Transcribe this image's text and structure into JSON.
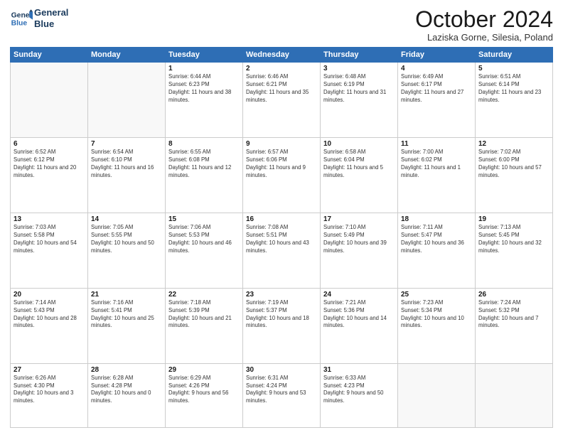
{
  "logo": {
    "line1": "General",
    "line2": "Blue"
  },
  "title": "October 2024",
  "subtitle": "Laziska Gorne, Silesia, Poland",
  "days_of_week": [
    "Sunday",
    "Monday",
    "Tuesday",
    "Wednesday",
    "Thursday",
    "Friday",
    "Saturday"
  ],
  "weeks": [
    [
      {
        "day": "",
        "sunrise": "",
        "sunset": "",
        "daylight": ""
      },
      {
        "day": "",
        "sunrise": "",
        "sunset": "",
        "daylight": ""
      },
      {
        "day": "1",
        "sunrise": "Sunrise: 6:44 AM",
        "sunset": "Sunset: 6:23 PM",
        "daylight": "Daylight: 11 hours and 38 minutes."
      },
      {
        "day": "2",
        "sunrise": "Sunrise: 6:46 AM",
        "sunset": "Sunset: 6:21 PM",
        "daylight": "Daylight: 11 hours and 35 minutes."
      },
      {
        "day": "3",
        "sunrise": "Sunrise: 6:48 AM",
        "sunset": "Sunset: 6:19 PM",
        "daylight": "Daylight: 11 hours and 31 minutes."
      },
      {
        "day": "4",
        "sunrise": "Sunrise: 6:49 AM",
        "sunset": "Sunset: 6:17 PM",
        "daylight": "Daylight: 11 hours and 27 minutes."
      },
      {
        "day": "5",
        "sunrise": "Sunrise: 6:51 AM",
        "sunset": "Sunset: 6:14 PM",
        "daylight": "Daylight: 11 hours and 23 minutes."
      }
    ],
    [
      {
        "day": "6",
        "sunrise": "Sunrise: 6:52 AM",
        "sunset": "Sunset: 6:12 PM",
        "daylight": "Daylight: 11 hours and 20 minutes."
      },
      {
        "day": "7",
        "sunrise": "Sunrise: 6:54 AM",
        "sunset": "Sunset: 6:10 PM",
        "daylight": "Daylight: 11 hours and 16 minutes."
      },
      {
        "day": "8",
        "sunrise": "Sunrise: 6:55 AM",
        "sunset": "Sunset: 6:08 PM",
        "daylight": "Daylight: 11 hours and 12 minutes."
      },
      {
        "day": "9",
        "sunrise": "Sunrise: 6:57 AM",
        "sunset": "Sunset: 6:06 PM",
        "daylight": "Daylight: 11 hours and 9 minutes."
      },
      {
        "day": "10",
        "sunrise": "Sunrise: 6:58 AM",
        "sunset": "Sunset: 6:04 PM",
        "daylight": "Daylight: 11 hours and 5 minutes."
      },
      {
        "day": "11",
        "sunrise": "Sunrise: 7:00 AM",
        "sunset": "Sunset: 6:02 PM",
        "daylight": "Daylight: 11 hours and 1 minute."
      },
      {
        "day": "12",
        "sunrise": "Sunrise: 7:02 AM",
        "sunset": "Sunset: 6:00 PM",
        "daylight": "Daylight: 10 hours and 57 minutes."
      }
    ],
    [
      {
        "day": "13",
        "sunrise": "Sunrise: 7:03 AM",
        "sunset": "Sunset: 5:58 PM",
        "daylight": "Daylight: 10 hours and 54 minutes."
      },
      {
        "day": "14",
        "sunrise": "Sunrise: 7:05 AM",
        "sunset": "Sunset: 5:55 PM",
        "daylight": "Daylight: 10 hours and 50 minutes."
      },
      {
        "day": "15",
        "sunrise": "Sunrise: 7:06 AM",
        "sunset": "Sunset: 5:53 PM",
        "daylight": "Daylight: 10 hours and 46 minutes."
      },
      {
        "day": "16",
        "sunrise": "Sunrise: 7:08 AM",
        "sunset": "Sunset: 5:51 PM",
        "daylight": "Daylight: 10 hours and 43 minutes."
      },
      {
        "day": "17",
        "sunrise": "Sunrise: 7:10 AM",
        "sunset": "Sunset: 5:49 PM",
        "daylight": "Daylight: 10 hours and 39 minutes."
      },
      {
        "day": "18",
        "sunrise": "Sunrise: 7:11 AM",
        "sunset": "Sunset: 5:47 PM",
        "daylight": "Daylight: 10 hours and 36 minutes."
      },
      {
        "day": "19",
        "sunrise": "Sunrise: 7:13 AM",
        "sunset": "Sunset: 5:45 PM",
        "daylight": "Daylight: 10 hours and 32 minutes."
      }
    ],
    [
      {
        "day": "20",
        "sunrise": "Sunrise: 7:14 AM",
        "sunset": "Sunset: 5:43 PM",
        "daylight": "Daylight: 10 hours and 28 minutes."
      },
      {
        "day": "21",
        "sunrise": "Sunrise: 7:16 AM",
        "sunset": "Sunset: 5:41 PM",
        "daylight": "Daylight: 10 hours and 25 minutes."
      },
      {
        "day": "22",
        "sunrise": "Sunrise: 7:18 AM",
        "sunset": "Sunset: 5:39 PM",
        "daylight": "Daylight: 10 hours and 21 minutes."
      },
      {
        "day": "23",
        "sunrise": "Sunrise: 7:19 AM",
        "sunset": "Sunset: 5:37 PM",
        "daylight": "Daylight: 10 hours and 18 minutes."
      },
      {
        "day": "24",
        "sunrise": "Sunrise: 7:21 AM",
        "sunset": "Sunset: 5:36 PM",
        "daylight": "Daylight: 10 hours and 14 minutes."
      },
      {
        "day": "25",
        "sunrise": "Sunrise: 7:23 AM",
        "sunset": "Sunset: 5:34 PM",
        "daylight": "Daylight: 10 hours and 10 minutes."
      },
      {
        "day": "26",
        "sunrise": "Sunrise: 7:24 AM",
        "sunset": "Sunset: 5:32 PM",
        "daylight": "Daylight: 10 hours and 7 minutes."
      }
    ],
    [
      {
        "day": "27",
        "sunrise": "Sunrise: 6:26 AM",
        "sunset": "Sunset: 4:30 PM",
        "daylight": "Daylight: 10 hours and 3 minutes."
      },
      {
        "day": "28",
        "sunrise": "Sunrise: 6:28 AM",
        "sunset": "Sunset: 4:28 PM",
        "daylight": "Daylight: 10 hours and 0 minutes."
      },
      {
        "day": "29",
        "sunrise": "Sunrise: 6:29 AM",
        "sunset": "Sunset: 4:26 PM",
        "daylight": "Daylight: 9 hours and 56 minutes."
      },
      {
        "day": "30",
        "sunrise": "Sunrise: 6:31 AM",
        "sunset": "Sunset: 4:24 PM",
        "daylight": "Daylight: 9 hours and 53 minutes."
      },
      {
        "day": "31",
        "sunrise": "Sunrise: 6:33 AM",
        "sunset": "Sunset: 4:23 PM",
        "daylight": "Daylight: 9 hours and 50 minutes."
      },
      {
        "day": "",
        "sunrise": "",
        "sunset": "",
        "daylight": ""
      },
      {
        "day": "",
        "sunrise": "",
        "sunset": "",
        "daylight": ""
      }
    ]
  ]
}
